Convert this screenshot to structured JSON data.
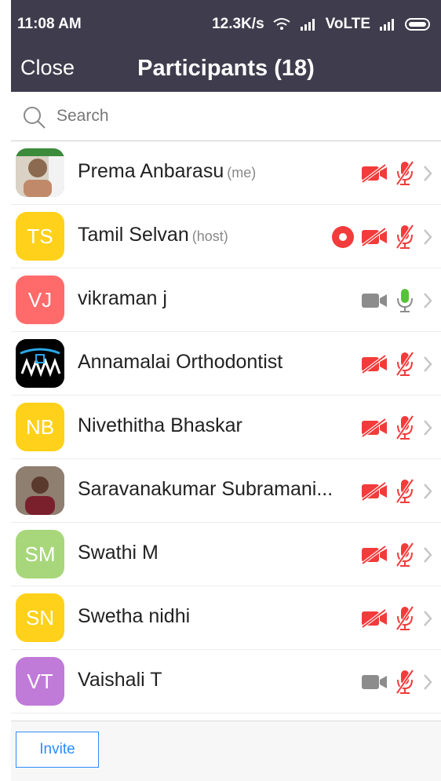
{
  "status": {
    "time": "11:08 AM",
    "speed": "12.3K/s",
    "network": "VoLTE"
  },
  "header": {
    "close_label": "Close",
    "title": "Participants (18)"
  },
  "search": {
    "placeholder": "Search"
  },
  "participants": [
    {
      "name": "Prema Anbarasu",
      "tag": "(me)",
      "initials": "",
      "avatar_color": "#7b8b6d",
      "video": "off",
      "mic": "muted",
      "recording": false
    },
    {
      "name": "Tamil Selvan",
      "tag": "(host)",
      "initials": "TS",
      "avatar_color": "#ffd11a",
      "video": "off",
      "mic": "muted",
      "recording": true
    },
    {
      "name": "vikraman j",
      "tag": "",
      "initials": "VJ",
      "avatar_color": "#ff6b6b",
      "video": "on",
      "mic": "on",
      "recording": false
    },
    {
      "name": "Annamalai Orthodontist",
      "tag": "",
      "initials": "",
      "avatar_color": "#000000",
      "video": "off",
      "mic": "muted",
      "recording": false
    },
    {
      "name": "Nivethitha Bhaskar",
      "tag": "",
      "initials": "NB",
      "avatar_color": "#ffd11a",
      "video": "off",
      "mic": "muted",
      "recording": false
    },
    {
      "name": "Saravanakumar Subramani...",
      "tag": "",
      "initials": "",
      "avatar_color": "#6a4a3f",
      "video": "off",
      "mic": "muted",
      "recording": false
    },
    {
      "name": "Swathi M",
      "tag": "",
      "initials": "SM",
      "avatar_color": "#a7d77a",
      "video": "off",
      "mic": "muted",
      "recording": false
    },
    {
      "name": "Swetha nidhi",
      "tag": "",
      "initials": "SN",
      "avatar_color": "#ffd11a",
      "video": "off",
      "mic": "muted",
      "recording": false
    },
    {
      "name": "Vaishali T",
      "tag": "",
      "initials": "VT",
      "avatar_color": "#c07ad8",
      "video": "on",
      "mic": "muted",
      "recording": false
    }
  ],
  "footer": {
    "invite_label": "Invite"
  },
  "colors": {
    "muted_red": "#f23b3b",
    "mic_green": "#56c23a",
    "header_bg": "#3f3d4d",
    "accent_blue": "#2d8cff"
  }
}
